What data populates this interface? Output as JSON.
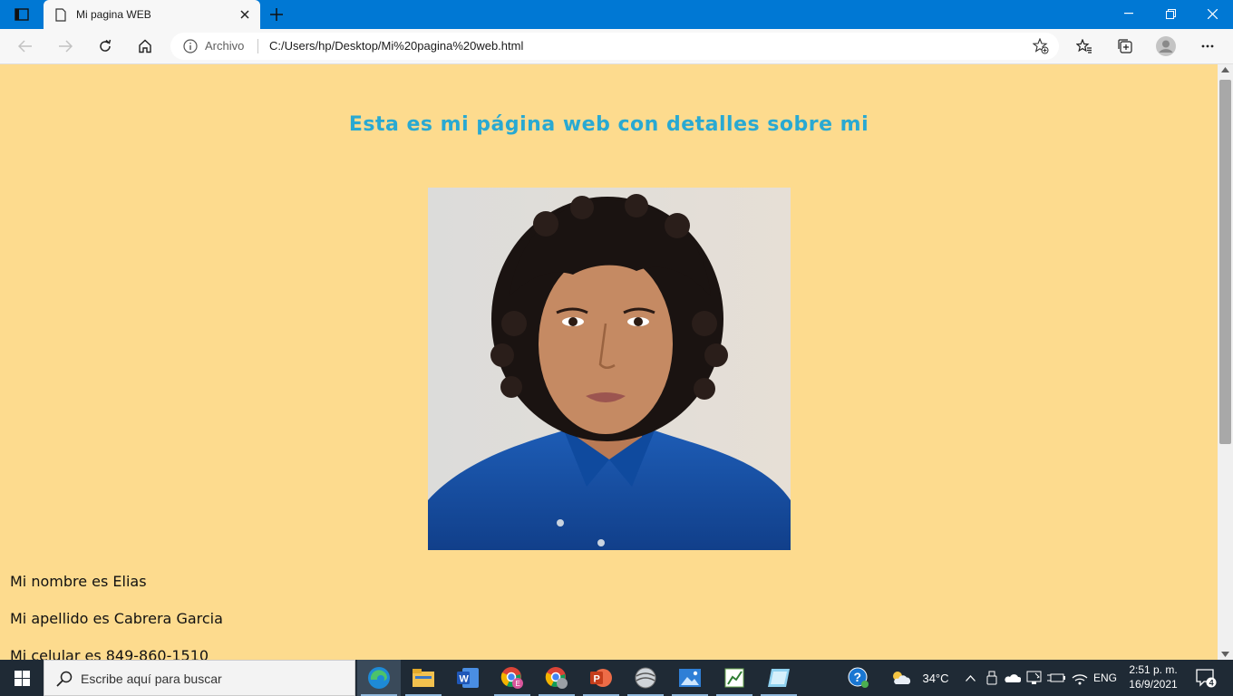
{
  "browser": {
    "tab_title": "Mi pagina WEB",
    "address_scheme": "Archivo",
    "address_url": "C:/Users/hp/Desktop/Mi%20pagina%20web.html"
  },
  "page": {
    "heading": "Esta es mi página web con detalles sobre mi",
    "name_line": "Mi nombre es Elias",
    "surname_line": "Mi apellido es Cabrera Garcia",
    "phone_line": "Mi celular es 849-860-1510"
  },
  "taskbar": {
    "search_placeholder": "Escribe aquí para buscar",
    "weather": "34°C",
    "language": "ENG",
    "time": "2:51 p. m.",
    "date": "16/9/2021",
    "notifications": "4"
  },
  "colors": {
    "page_bg": "#fddb8e",
    "heading": "#29a9d2",
    "titlebar": "#0078d4"
  }
}
